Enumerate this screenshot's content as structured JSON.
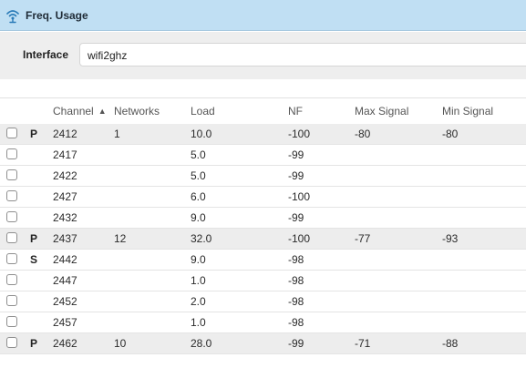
{
  "window": {
    "title": "Freq. Usage"
  },
  "interface": {
    "label": "Interface",
    "value": "wifi2ghz"
  },
  "table": {
    "columns": [
      {
        "key": "channel",
        "label": "Channel",
        "sorted": "ascending"
      },
      {
        "key": "networks",
        "label": "Networks"
      },
      {
        "key": "load",
        "label": "Load"
      },
      {
        "key": "nf",
        "label": "NF"
      },
      {
        "key": "max_signal",
        "label": "Max Signal"
      },
      {
        "key": "min_signal",
        "label": "Min Signal"
      }
    ],
    "rows": [
      {
        "flag": "P",
        "channel": "2412",
        "networks": "1",
        "load": "10.0",
        "nf": "-100",
        "max_signal": "-80",
        "min_signal": "-80",
        "checked": false
      },
      {
        "flag": "",
        "channel": "2417",
        "networks": "",
        "load": "5.0",
        "nf": "-99",
        "max_signal": "",
        "min_signal": "",
        "checked": false
      },
      {
        "flag": "",
        "channel": "2422",
        "networks": "",
        "load": "5.0",
        "nf": "-99",
        "max_signal": "",
        "min_signal": "",
        "checked": false
      },
      {
        "flag": "",
        "channel": "2427",
        "networks": "",
        "load": "6.0",
        "nf": "-100",
        "max_signal": "",
        "min_signal": "",
        "checked": false
      },
      {
        "flag": "",
        "channel": "2432",
        "networks": "",
        "load": "9.0",
        "nf": "-99",
        "max_signal": "",
        "min_signal": "",
        "checked": false
      },
      {
        "flag": "P",
        "channel": "2437",
        "networks": "12",
        "load": "32.0",
        "nf": "-100",
        "max_signal": "-77",
        "min_signal": "-93",
        "checked": false
      },
      {
        "flag": "S",
        "channel": "2442",
        "networks": "",
        "load": "9.0",
        "nf": "-98",
        "max_signal": "",
        "min_signal": "",
        "checked": false
      },
      {
        "flag": "",
        "channel": "2447",
        "networks": "",
        "load": "1.0",
        "nf": "-98",
        "max_signal": "",
        "min_signal": "",
        "checked": false
      },
      {
        "flag": "",
        "channel": "2452",
        "networks": "",
        "load": "2.0",
        "nf": "-98",
        "max_signal": "",
        "min_signal": "",
        "checked": false
      },
      {
        "flag": "",
        "channel": "2457",
        "networks": "",
        "load": "1.0",
        "nf": "-98",
        "max_signal": "",
        "min_signal": "",
        "checked": false
      },
      {
        "flag": "P",
        "channel": "2462",
        "networks": "10",
        "load": "28.0",
        "nf": "-99",
        "max_signal": "-71",
        "min_signal": "-88",
        "checked": false
      }
    ]
  },
  "icons": {
    "title": "wifi-icon",
    "sort": "sort-ascending-icon",
    "row_select": "checkbox-icon"
  },
  "colors": {
    "titlebar": "#c0dff3",
    "icon": "#2a7bb8",
    "form_bg": "#eeeeee",
    "row_shaded": "#ededed"
  }
}
